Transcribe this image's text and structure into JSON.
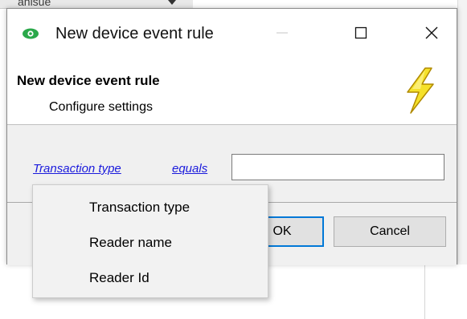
{
  "background": {
    "fragment_text": "anisue"
  },
  "dialog": {
    "title": "New device event rule",
    "window_controls": {
      "minimize_icon": "minimize-icon",
      "maximize_icon": "maximize-icon",
      "close_icon": "close-icon"
    },
    "header": {
      "title": "New device event rule",
      "subtitle": "Configure settings",
      "icon": "lightning-bolt-icon"
    },
    "condition": {
      "field_link": "Transaction type",
      "operator_link": "equals",
      "value": "",
      "placeholder": ""
    },
    "buttons": {
      "ok_label": "OK",
      "cancel_label": "Cancel"
    }
  },
  "dropdown_menu": {
    "items": [
      "Transaction type",
      "Reader name",
      "Reader Id"
    ]
  },
  "colors": {
    "link": "#1a1adc",
    "focus_border": "#0078d7",
    "dialog_bg": "#f0f0f0",
    "bolt_fill": "#f5e12a",
    "app_icon_green": "#2aa84a"
  }
}
